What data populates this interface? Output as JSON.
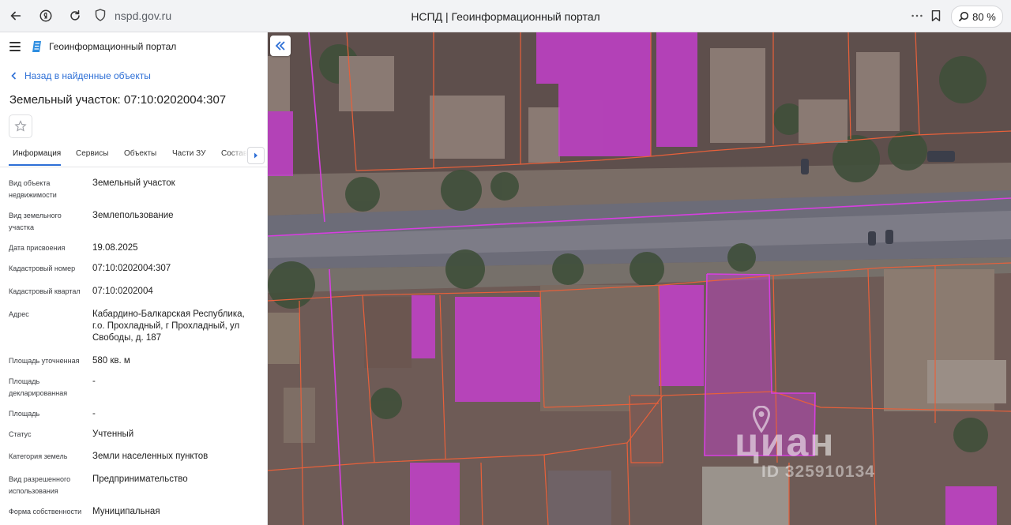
{
  "browser": {
    "url": "nspd.gov.ru",
    "title": "НСПД | Геоинформационный портал",
    "zoom": "80 %"
  },
  "panel": {
    "portal_name": "Геоинформационный портал",
    "back_link": "Назад в найденные объекты",
    "object_title": "Земельный участок: 07:10:0202004:307",
    "tabs": [
      "Информация",
      "Сервисы",
      "Объекты",
      "Части ЗУ",
      "Состав"
    ],
    "active_tab": "Информация",
    "properties": [
      {
        "label": "Вид объекта недвижимости",
        "value": "Земельный участок"
      },
      {
        "label": "Вид земельного участка",
        "value": "Землепользование"
      },
      {
        "label": "Дата присвоения",
        "value": "19.08.2025"
      },
      {
        "label": "Кадастровый номер",
        "value": "07:10:0202004:307"
      },
      {
        "label": "Кадастровый квартал",
        "value": "07:10:0202004"
      },
      {
        "label": "Адрес",
        "value": "Кабардино-Балкарская Республика, г.о. Прохладный, г Прохладный, ул Свободы, д. 187"
      },
      {
        "label": "Площадь уточненная",
        "value": "580 кв. м"
      },
      {
        "label": "Площадь декларированная",
        "value": "-"
      },
      {
        "label": "Площадь",
        "value": "-"
      },
      {
        "label": "Статус",
        "value": "Учтенный"
      },
      {
        "label": "Категория земель",
        "value": "Земли населенных пунктов"
      },
      {
        "label": "Вид разрешенного использования",
        "value": "Предпринимательство"
      },
      {
        "label": "Форма собственности",
        "value": "Муниципальная"
      }
    ]
  },
  "map": {
    "watermark_logo": "циан",
    "watermark_id": "ID 325910134",
    "colors": {
      "parcel_highlight": "#c63fcf",
      "parcel_border": "#e8603a"
    }
  }
}
